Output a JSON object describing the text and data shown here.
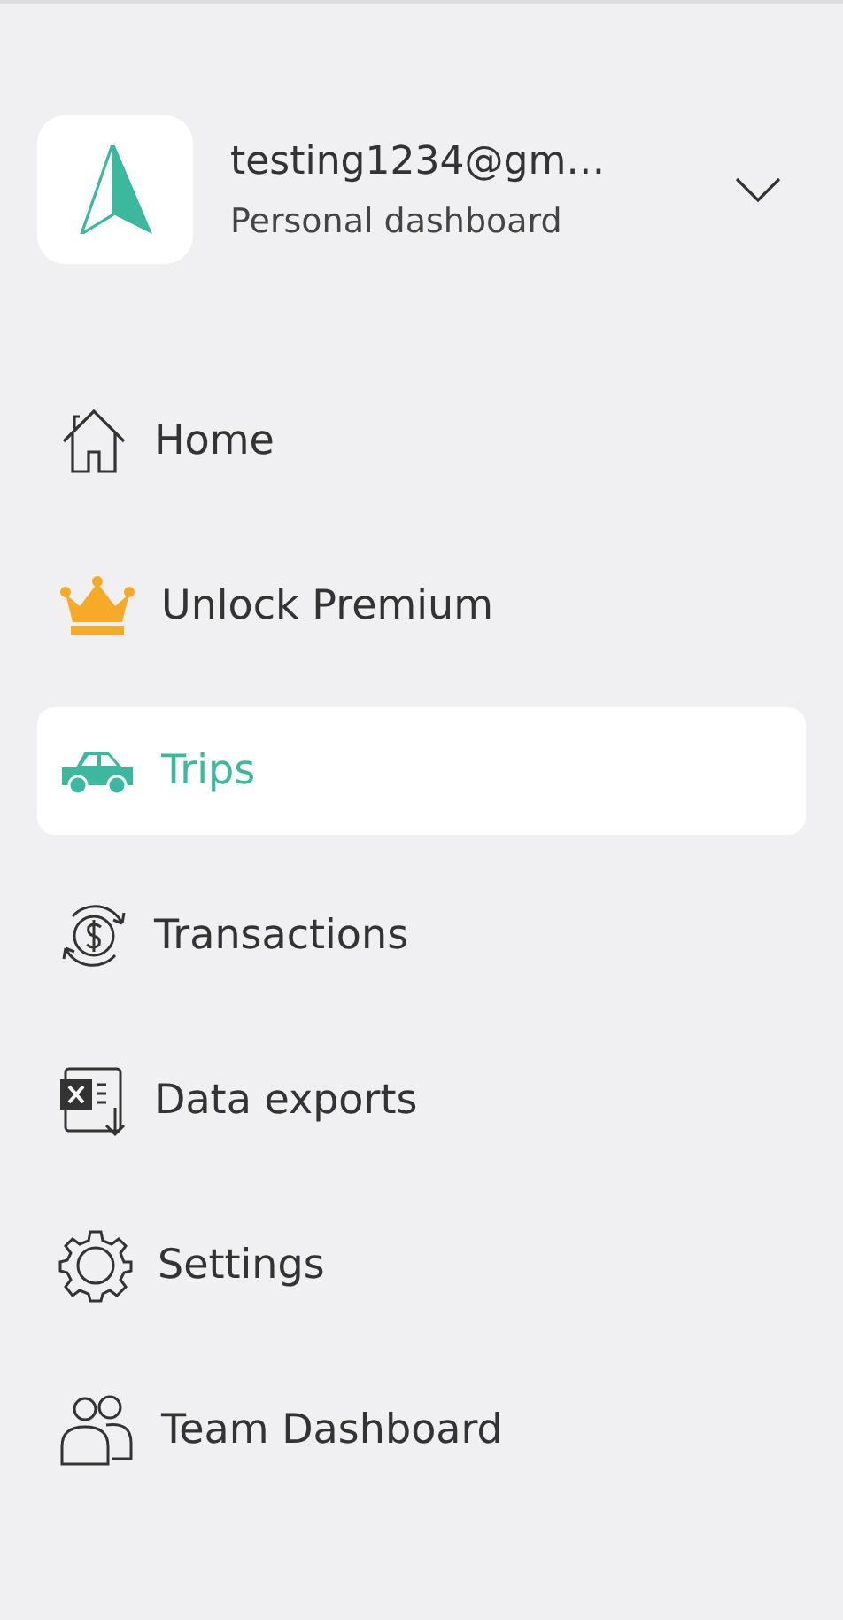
{
  "account": {
    "email": "testing1234@gm…",
    "subtitle": "Personal dashboard"
  },
  "menu": [
    {
      "kind": "home",
      "label": "Home",
      "selected": false
    },
    {
      "kind": "crown",
      "label": "Unlock Premium",
      "selected": false
    },
    {
      "kind": "car",
      "label": "Trips",
      "selected": true
    },
    {
      "kind": "transactions",
      "label": "Transactions",
      "selected": false
    },
    {
      "kind": "export",
      "label": "Data exports",
      "selected": false
    },
    {
      "kind": "settings",
      "label": "Settings",
      "selected": false
    },
    {
      "kind": "team",
      "label": "Team Dashboard",
      "selected": false
    }
  ]
}
